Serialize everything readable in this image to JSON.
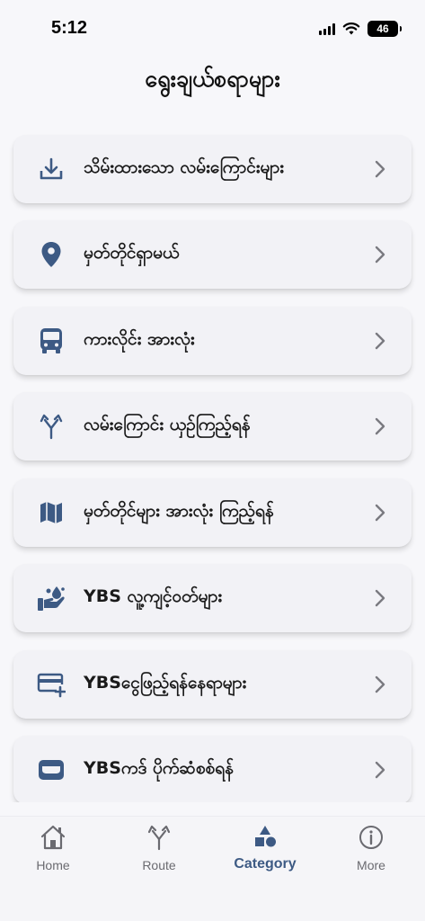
{
  "status_bar": {
    "time": "5:12",
    "battery": "46"
  },
  "header": {
    "title": "ရွေးချယ်စရာများ"
  },
  "menu": {
    "items": [
      {
        "label": "သိမ်းထားသော လမ်းကြောင်းများ",
        "icon": "download-icon"
      },
      {
        "label": "မှတ်တိုင်ရှာမယ်",
        "icon": "location-pin-icon"
      },
      {
        "label": "ကားလိုင်း အားလုံး",
        "icon": "bus-icon"
      },
      {
        "label": "လမ်းကြောင်း ယှဉ်ကြည့်ရန်",
        "icon": "merge-route-icon"
      },
      {
        "label": "မှတ်တိုင်များ အားလုံး ကြည့်ရန်",
        "icon": "map-icon"
      },
      {
        "label": "YBS လူ့ကျင့်ဝတ်များ",
        "icon": "hand-care-icon"
      },
      {
        "label": "YBSငွေဖြည့်ရန်နေရာများ",
        "icon": "card-add-icon"
      },
      {
        "label": "YBSကဒ် ပိုက်ဆံစစ်ရန်",
        "icon": "wallet-card-icon"
      }
    ]
  },
  "tab_bar": {
    "tabs": [
      {
        "label": "Home",
        "icon": "home-icon"
      },
      {
        "label": "Route",
        "icon": "route-icon"
      },
      {
        "label": "Category",
        "icon": "category-icon",
        "active": true
      },
      {
        "label": "More",
        "icon": "info-icon"
      }
    ]
  },
  "colors": {
    "accent": "#3d5a84",
    "card_bg": "#f2f2f6",
    "page_bg": "#f7f7fa"
  }
}
